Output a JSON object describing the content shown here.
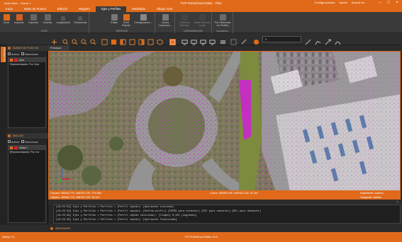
{
  "titlebar": {
    "title": "TCP-PointCloud Editor - Plus",
    "menu": "Inicio     Abrir...    Cerrar »",
    "right_items": [
      "Configuraciones",
      "Ayuda",
      "Acerca de..."
    ]
  },
  "tabs": [
    "Inicio",
    "Nube de Puntos",
    "Edición",
    "Registro",
    "Ejes y Perfiles",
    "Modelado",
    "Dibujo CAD"
  ],
  "active_tab": 4,
  "ribbon": {
    "groups": [
      {
        "label": "EJES",
        "buttons": [
          "Crear",
          "Importar",
          "Exportar",
          "Guardar",
          "Longitudinal",
          "Transversal"
        ]
      },
      {
        "label": "PERFILES",
        "buttons": [
          "Editar",
          "Perfil Rápido",
          "Configuración..."
        ]
      },
      {
        "label": "",
        "buttons": [
          "Cortes Conjuntos..."
        ]
      },
      {
        "label": "HERRAMIENTAS",
        "buttons": [
          "Conexión Dobleas",
          "Vistas Sección Local"
        ]
      },
      {
        "label": "Volumenes",
        "buttons": [
          "Por Diferencia de Perfiles"
        ]
      }
    ]
  },
  "toolbar": {
    "combo_value": "0"
  },
  "leftpanel": {
    "strip_label": "PROYECTO",
    "point_cloud_section": {
      "title": "NUBES DE PUNTOS",
      "activate": "Activar",
      "select": "Seleccionar",
      "items": [
        {
          "name": "plan",
          "selected": true
        },
        {
          "name": "Representación: Por Colo",
          "selected": false
        }
      ]
    },
    "meshes_section": {
      "title": "MALLAS",
      "activate": "Activar",
      "select": "Seleccionar",
      "items": [
        {
          "name": "Malla 1",
          "selected": true
        },
        {
          "name": "[Representación]: Por Col",
          "selected": false
        }
      ]
    }
  },
  "viewport": {
    "tab_label": "Principal"
  },
  "statusbar": {
    "cursor_left": "Cámara: 360842.775, 4087927.257, 375.966",
    "object_left": "Objetivo: 360842.775, 4087927.257, 84.417",
    "cursor_mid": "Cursor: 360999.296, 4087824.232, 51.284",
    "snap": "Snap/Mode: Inactivo",
    "ortho": "Ortogonal: Inactivo"
  },
  "log": {
    "lines": [
      "[18:25:33] Ejes y Perfiles > Perfiles > (Perfil rápido): [Operación iniciada]",
      "[18:25:33] Ejes y Perfiles > Perfiles > (Perfil rápido): [Defina perfil] [INTRO para terminar] [ESC para cancelar] [DEL para deshacer]",
      "[18:25:39] Ejes y Perfiles > Perfiles > (Perfil rápido calculado): [Tiempo] 0,281 [segundos]",
      "[18:25:39] Ejes y Perfiles > Perfiles > (Perfil rápido): [Operación finalizada]"
    ]
  },
  "messages_label": "MENSAJES",
  "bottombar": {
    "left": "Aplitop, S.L.",
    "center": "TCP-PointCloud Editor v8.9"
  },
  "colors": {
    "accent": "#e06a1a",
    "magenta_points": "#d020d8",
    "roof": "#c9c9c9"
  }
}
